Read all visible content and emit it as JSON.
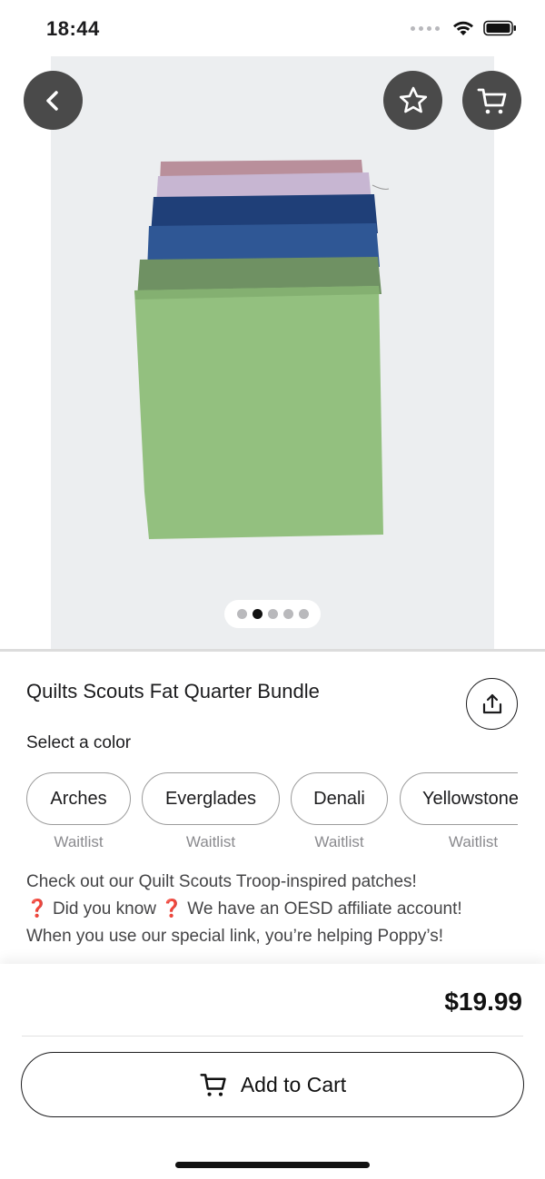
{
  "status_bar": {
    "time": "18:44"
  },
  "product": {
    "title": "Quilts Scouts Fat Quarter Bundle",
    "select_label": "Select a color",
    "image_pager": {
      "count": 5,
      "active_index": 1
    },
    "colors": [
      {
        "name": "Arches",
        "status": "Waitlist"
      },
      {
        "name": "Everglades",
        "status": "Waitlist"
      },
      {
        "name": "Denali",
        "status": "Waitlist"
      },
      {
        "name": "Yellowstone",
        "status": "Waitlist"
      }
    ],
    "description": {
      "line1": "Check out our Quilt Scouts Troop-inspired patches!",
      "line2_q1": "❓",
      "line2_text": " Did you know ",
      "line2_q2": "❓",
      "line2_rest": "  We have an OESD affiliate account!",
      "line3": "When you use our special link, you’re helping Poppy’s!"
    }
  },
  "purchase": {
    "price": "$19.99",
    "add_to_cart_label": "Add to Cart"
  },
  "icons": [
    "back-icon",
    "star-icon",
    "cart-icon",
    "share-icon",
    "wifi-icon",
    "battery-icon"
  ]
}
